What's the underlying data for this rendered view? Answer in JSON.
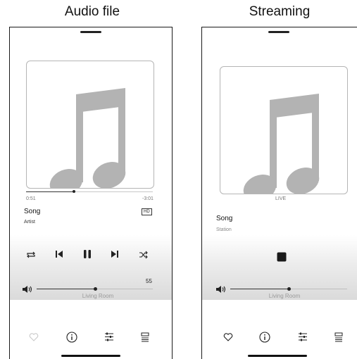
{
  "left_panel": {
    "title": "Audio file",
    "elapsed": "0:51",
    "remaining": "-3:01",
    "progress": 0.44,
    "song": "Song",
    "artist": "Artist",
    "hd_badge": "HD",
    "volume_value": "55",
    "volume_level": 0.55,
    "room": "Living Room",
    "controls": [
      "repeat-icon",
      "previous-icon",
      "pause-icon",
      "next-icon",
      "shuffle-icon"
    ],
    "bottom_icons": [
      "heart-icon",
      "info-icon",
      "equalizer-icon",
      "queue-icon"
    ]
  },
  "right_panel": {
    "title": "Streaming",
    "live_label": "LIVE",
    "song": "Song",
    "station": "Station",
    "volume_level": 0.55,
    "room": "Living Room",
    "controls": [
      "stop-icon"
    ],
    "bottom_icons": [
      "heart-icon",
      "info-icon",
      "equalizer-icon",
      "queue-icon"
    ]
  },
  "colors": {
    "note": "#b3b3b3",
    "heart_left": "#c9c9c9",
    "icon": "#222222"
  }
}
